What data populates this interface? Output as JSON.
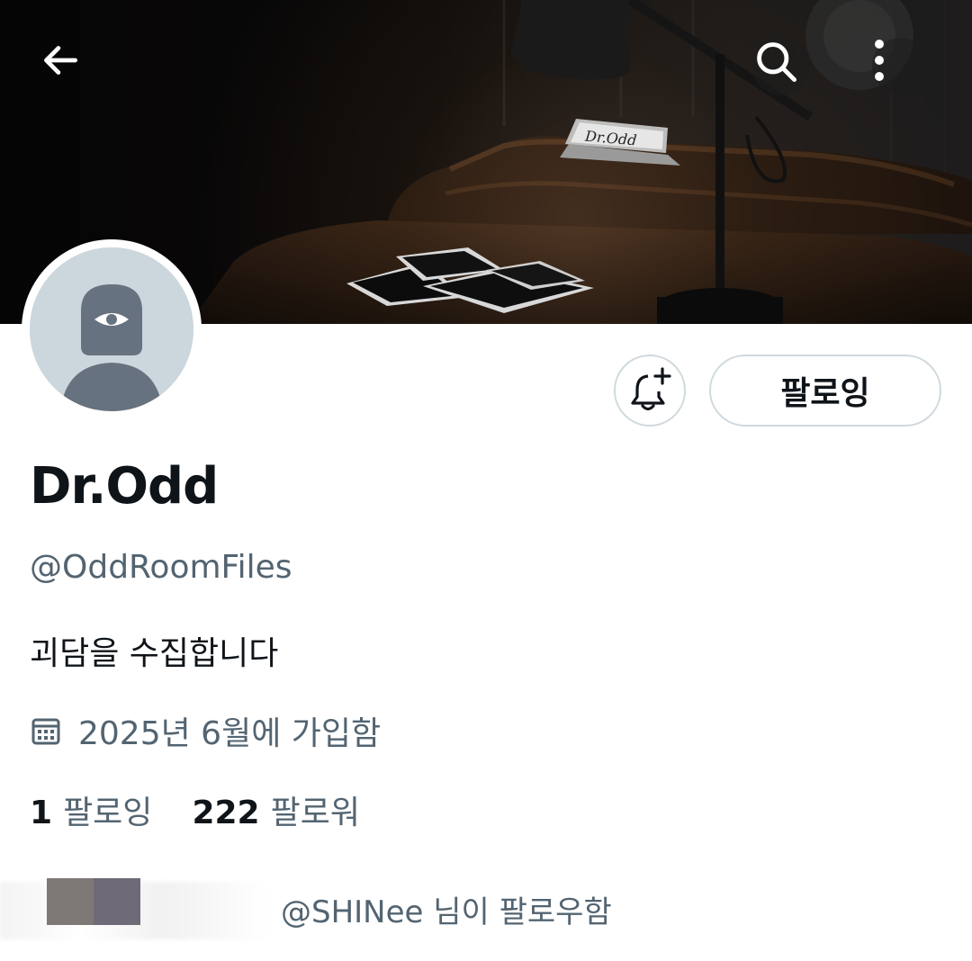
{
  "banner": {
    "nameplate_text": "Dr.Odd"
  },
  "nav": {
    "back_icon": "arrow-left-icon",
    "search_icon": "search-icon",
    "more_icon": "more-vertical-icon"
  },
  "actions": {
    "notify_icon": "bell-plus-icon",
    "follow_label": "팔로잉"
  },
  "profile": {
    "display_name": "Dr.Odd",
    "handle": "@OddRoomFiles",
    "bio": "괴담을 수집합니다",
    "joined_icon": "calendar-icon",
    "joined": "2025년 6월에 가입함"
  },
  "stats": {
    "following_count": "1",
    "following_label": "팔로잉",
    "followers_count": "222",
    "followers_label": "팔로워"
  },
  "followed_by": {
    "text": "@SHINee 님이 팔로우함"
  },
  "colors": {
    "text_primary": "#0f1419",
    "text_secondary": "#536471",
    "border": "#cfd9de",
    "avatar_bg": "#ccd6dd",
    "avatar_fg": "#66727f"
  }
}
